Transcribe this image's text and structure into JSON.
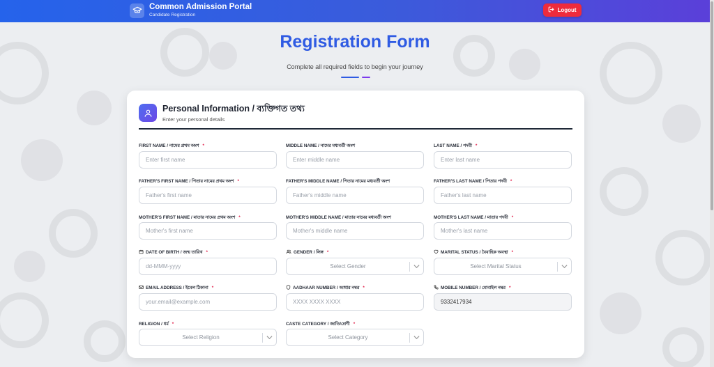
{
  "header": {
    "title": "Common Admission Portal",
    "subtitle": "Candidate Registration",
    "logout_label": "Logout"
  },
  "hero": {
    "title": "Registration Form",
    "subtitle": "Complete all required fields to begin your journey"
  },
  "section": {
    "title": "Personal Information / ব্যক্তিগত তথ্য",
    "subtitle": "Enter your personal details"
  },
  "fields": {
    "first_name": {
      "label": "FIRST NAME / নামের প্রথম অংশ",
      "placeholder": "Enter first name"
    },
    "middle_name": {
      "label": "MIDDLE NAME / নামের মধ্যবর্তী অংশ",
      "placeholder": "Enter middle name"
    },
    "last_name": {
      "label": "LAST NAME / পদবী",
      "placeholder": "Enter last name"
    },
    "father_first": {
      "label": "FATHER'S FIRST NAME / পিতার নামের প্রথম অংশ",
      "placeholder": "Father's first name"
    },
    "father_middle": {
      "label": "FATHER'S MIDDLE NAME / পিতার নামের মধ্যবর্তী অংশ",
      "placeholder": "Father's middle name"
    },
    "father_last": {
      "label": "FATHER'S LAST NAME / পিতার পদবী",
      "placeholder": "Father's last name"
    },
    "mother_first": {
      "label": "MOTHER'S FIRST NAME / মাতার নামের প্রথম অংশ",
      "placeholder": "Mother's first name"
    },
    "mother_middle": {
      "label": "MOTHER'S MIDDLE NAME / মাতার নামের মধ্যবর্তী অংশ",
      "placeholder": "Mother's middle name"
    },
    "mother_last": {
      "label": "MOTHER'S LAST NAME / মাতার পদবী",
      "placeholder": "Mother's last name"
    },
    "dob": {
      "label": "DATE OF BIRTH / জন্ম তারিখ",
      "placeholder": "dd-MMM-yyyy",
      "icon": "calendar-icon"
    },
    "gender": {
      "label": "GENDER / লিঙ্গ",
      "value": "Select Gender",
      "icon": "users-icon"
    },
    "marital": {
      "label": "MARITAL STATUS / বৈবাহিক অবস্থা",
      "value": "Select Marital Status",
      "icon": "heart-icon"
    },
    "email": {
      "label": "EMAIL ADDRESS / ইমেল ঠিকানা",
      "placeholder": "your.email@example.com",
      "icon": "mail-icon"
    },
    "aadhaar": {
      "label": "AADHAAR NUMBER / আধার নম্বর",
      "placeholder": "XXXX XXXX XXXX",
      "icon": "shield-icon"
    },
    "mobile": {
      "label": "MOBILE NUMBER / মোবাইল নম্বর",
      "value": "9332417934",
      "icon": "phone-icon"
    },
    "religion": {
      "label": "RELIGION / ধর্ম",
      "value": "Select Religion"
    },
    "caste": {
      "label": "CASTE CATEGORY / জাতি/শ্রেণী",
      "value": "Select Category"
    }
  },
  "required_mark": "*",
  "colors": {
    "primary": "#2f5be3",
    "header_start": "#2563eb",
    "header_end": "#5b3fd9",
    "logout": "#ef2b3c",
    "required": "#e11d48"
  }
}
